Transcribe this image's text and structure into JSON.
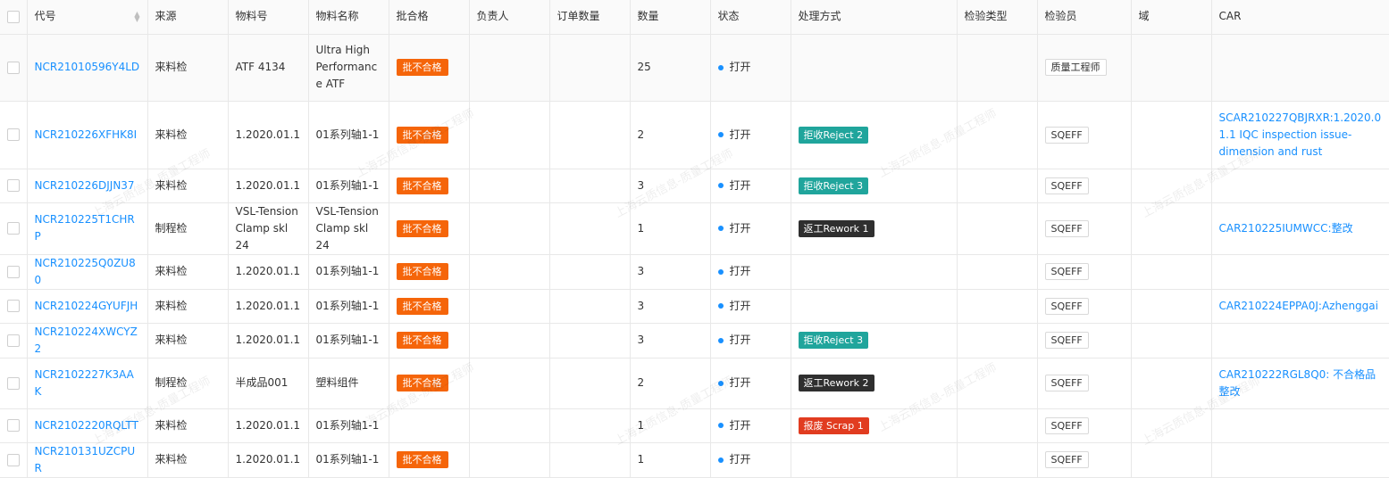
{
  "columns": [
    "代号",
    "来源",
    "物料号",
    "物料名称",
    "批合格",
    "负责人",
    "订单数量",
    "数量",
    "状态",
    "处理方式",
    "检验类型",
    "检验员",
    "域",
    "CAR"
  ],
  "watermark": "上海云质信息-质量工程师",
  "colors": {
    "link": "#1890ff",
    "reject_tag": "#f5650a",
    "teal": "#20a59c",
    "dark": "#2f2f2f",
    "scrap": "#e13c20",
    "status_dot": "#1890ff"
  },
  "rows": [
    {
      "code": "NCR21010596Y4LD",
      "source": "来料检",
      "material_no": "ATF 4134",
      "material_name": "Ultra High Performance ATF",
      "lot": "批不合格",
      "owner": "",
      "order_qty": "",
      "qty": "25",
      "status": "打开",
      "disposition": "",
      "disp_color": "",
      "inspection_type": "",
      "inspector": "质量工程师",
      "domain": "",
      "car": ""
    },
    {
      "code": "NCR210226XFHK8I",
      "source": "来料检",
      "material_no": "1.2020.01.1",
      "material_name": "01系列轴1-1",
      "lot": "批不合格",
      "owner": "",
      "order_qty": "",
      "qty": "2",
      "status": "打开",
      "disposition": "拒收Reject 2",
      "disp_color": "#20a59c",
      "inspection_type": "",
      "inspector": "SQEFF",
      "domain": "",
      "car": "SCAR210227QBJRXR:1.2020.01.1 IQC inspection issue-dimension and rust"
    },
    {
      "code": "NCR210226DJJN37",
      "source": "来料检",
      "material_no": "1.2020.01.1",
      "material_name": "01系列轴1-1",
      "lot": "批不合格",
      "owner": "",
      "order_qty": "",
      "qty": "3",
      "status": "打开",
      "disposition": "拒收Reject 3",
      "disp_color": "#20a59c",
      "inspection_type": "",
      "inspector": "SQEFF",
      "domain": "",
      "car": ""
    },
    {
      "code": "NCR210225T1CHRP",
      "source": "制程检",
      "material_no": "VSL-Tension Clamp skl 24",
      "material_name": "VSL-Tension Clamp skl 24",
      "lot": "批不合格",
      "owner": "",
      "order_qty": "",
      "qty": "1",
      "status": "打开",
      "disposition": "返工Rework 1",
      "disp_color": "#2f2f2f",
      "inspection_type": "",
      "inspector": "SQEFF",
      "domain": "",
      "car": "CAR210225IUMWCC:整改"
    },
    {
      "code": "NCR210225Q0ZU80",
      "source": "来料检",
      "material_no": "1.2020.01.1",
      "material_name": "01系列轴1-1",
      "lot": "批不合格",
      "owner": "",
      "order_qty": "",
      "qty": "3",
      "status": "打开",
      "disposition": "",
      "disp_color": "",
      "inspection_type": "",
      "inspector": "SQEFF",
      "domain": "",
      "car": ""
    },
    {
      "code": "NCR210224GYUFJH",
      "source": "来料检",
      "material_no": "1.2020.01.1",
      "material_name": "01系列轴1-1",
      "lot": "批不合格",
      "owner": "",
      "order_qty": "",
      "qty": "3",
      "status": "打开",
      "disposition": "",
      "disp_color": "",
      "inspection_type": "",
      "inspector": "SQEFF",
      "domain": "",
      "car": "CAR210224EPPA0J:Azhenggai"
    },
    {
      "code": "NCR210224XWCYZ2",
      "source": "来料检",
      "material_no": "1.2020.01.1",
      "material_name": "01系列轴1-1",
      "lot": "批不合格",
      "owner": "",
      "order_qty": "",
      "qty": "3",
      "status": "打开",
      "disposition": "拒收Reject 3",
      "disp_color": "#20a59c",
      "inspection_type": "",
      "inspector": "SQEFF",
      "domain": "",
      "car": ""
    },
    {
      "code": "NCR2102227K3AAK",
      "source": "制程检",
      "material_no": "半成品001",
      "material_name": "塑料组件",
      "lot": "批不合格",
      "owner": "",
      "order_qty": "",
      "qty": "2",
      "status": "打开",
      "disposition": "返工Rework 2",
      "disp_color": "#2f2f2f",
      "inspection_type": "",
      "inspector": "SQEFF",
      "domain": "",
      "car": "CAR210222RGL8Q0: 不合格品整改"
    },
    {
      "code": "NCR2102220RQLTT",
      "source": "来料检",
      "material_no": "1.2020.01.1",
      "material_name": "01系列轴1-1",
      "lot": "",
      "owner": "",
      "order_qty": "",
      "qty": "1",
      "status": "打开",
      "disposition": "报废 Scrap 1",
      "disp_color": "#e13c20",
      "inspection_type": "",
      "inspector": "SQEFF",
      "domain": "",
      "car": ""
    },
    {
      "code": "NCR210131UZCPUR",
      "source": "来料检",
      "material_no": "1.2020.01.1",
      "material_name": "01系列轴1-1",
      "lot": "批不合格",
      "owner": "",
      "order_qty": "",
      "qty": "1",
      "status": "打开",
      "disposition": "",
      "disp_color": "",
      "inspection_type": "",
      "inspector": "SQEFF",
      "domain": "",
      "car": ""
    }
  ]
}
